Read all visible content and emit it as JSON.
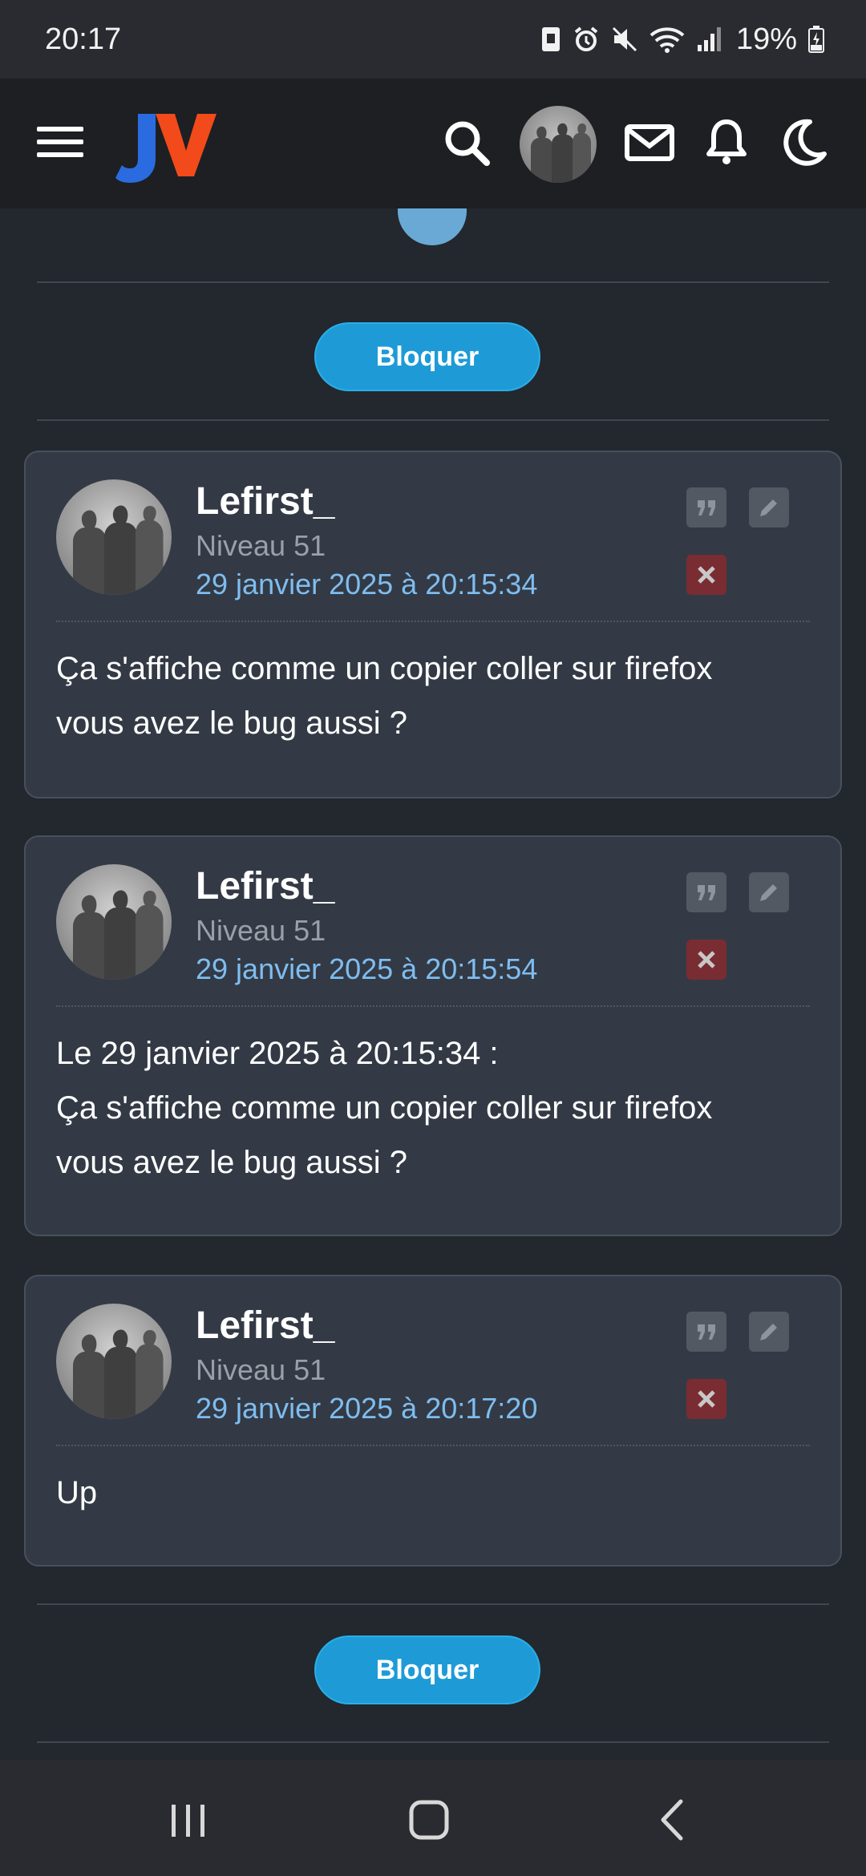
{
  "status_bar": {
    "time": "20:17",
    "battery": "19%"
  },
  "header": {
    "logo_text": "JV",
    "colors": {
      "logo_j": "#2b6be0",
      "logo_v": "#f24a1a",
      "background": "#1d1f23"
    },
    "icons": [
      "menu-icon",
      "search-icon",
      "avatar",
      "mail-icon",
      "bell-icon",
      "moon-icon"
    ]
  },
  "block_button_label": "Bloquer",
  "posts": [
    {
      "author": "Lefirst_",
      "level": "Niveau 51",
      "date": "29 janvier 2025 à 20:15:34",
      "body_lines": [
        "Ça s'affiche comme un copier coller sur firefox",
        "vous avez le bug aussi ?"
      ]
    },
    {
      "author": "Lefirst_",
      "level": "Niveau 51",
      "date": "29 janvier 2025 à 20:15:54",
      "body_lines": [
        "Le 29 janvier 2025 à 20:15:34 :",
        "Ça s'affiche comme un copier coller sur firefox",
        "vous avez le bug aussi ?"
      ]
    },
    {
      "author": "Lefirst_",
      "level": "Niveau 51",
      "date": "29 janvier 2025 à 20:17:20",
      "body_lines": [
        "Up"
      ]
    }
  ],
  "colors": {
    "accent": "#1e9bd7",
    "date_link": "#7fbdf0",
    "delete": "#7a2c33",
    "post_bg": "#333a45"
  }
}
